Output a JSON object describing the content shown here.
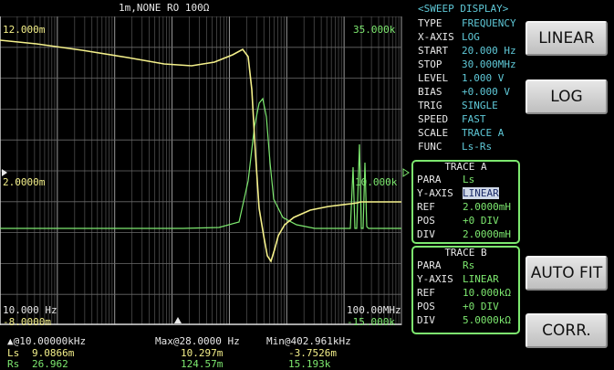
{
  "status": {
    "top": "1m,NONE   RO 100Ω"
  },
  "plot": {
    "y_left_top": "12.000m",
    "y_left_mid": "2.0000m",
    "y_left_bottom": "-8.0000m",
    "y_right_top": "35.000k",
    "y_right_mid": "10.000k",
    "y_right_bottom": "-15.000k",
    "x_start": "10.000 Hz",
    "x_stop": "100.00MHz",
    "colors": {
      "trace_a": "#f4f08a",
      "trace_b": "#7de86f",
      "grid": "#8a8a8a"
    }
  },
  "sweep": {
    "title": "<SWEEP DISPLAY>",
    "rows": [
      {
        "key": "TYPE",
        "value": "FREQUENCY"
      },
      {
        "key": "X-AXIS",
        "value": "LOG"
      },
      {
        "key": "START",
        "value": "20.000 Hz"
      },
      {
        "key": "STOP",
        "value": "30.000MHz"
      },
      {
        "key": "LEVEL",
        "value": "1.000 V"
      },
      {
        "key": "BIAS",
        "value": "+0.000 V"
      },
      {
        "key": "TRIG",
        "value": "SINGLE"
      },
      {
        "key": "SPEED",
        "value": "FAST"
      },
      {
        "key": "SCALE",
        "value": "TRACE A"
      },
      {
        "key": "FUNC",
        "value": "Ls-Rs"
      }
    ]
  },
  "trace_a": {
    "title": "TRACE A",
    "rows": [
      {
        "key": "PARA",
        "value": "Ls"
      },
      {
        "key": "Y-AXIS",
        "value": "LINEAR"
      },
      {
        "key": "REF",
        "value": "2.0000mH"
      },
      {
        "key": "POS",
        "value": "+0 DIV"
      },
      {
        "key": "DIV",
        "value": "2.0000mH"
      }
    ]
  },
  "trace_b": {
    "title": "TRACE B",
    "rows": [
      {
        "key": "PARA",
        "value": "Rs"
      },
      {
        "key": "Y-AXIS",
        "value": "LINEAR"
      },
      {
        "key": "REF",
        "value": "10.000kΩ"
      },
      {
        "key": "POS",
        "value": "+0 DIV"
      },
      {
        "key": "DIV",
        "value": "5.0000kΩ"
      }
    ]
  },
  "softkeys": {
    "linear": "LINEAR",
    "log": "LOG",
    "auto_fit": "AUTO FIT",
    "corr": "CORR."
  },
  "markers": {
    "cursor_label": "▲@10.00000kHz",
    "max_label": "Max@28.0000 Hz",
    "min_label": "Min@402.961kHz",
    "ls_label": "Ls",
    "rs_label": "Rs",
    "ls_cursor": "9.0866m",
    "rs_cursor": "26.962",
    "ls_max": "10.297m",
    "rs_max": "124.57m",
    "ls_min": "-3.7526m",
    "rs_min": "15.193k"
  }
}
